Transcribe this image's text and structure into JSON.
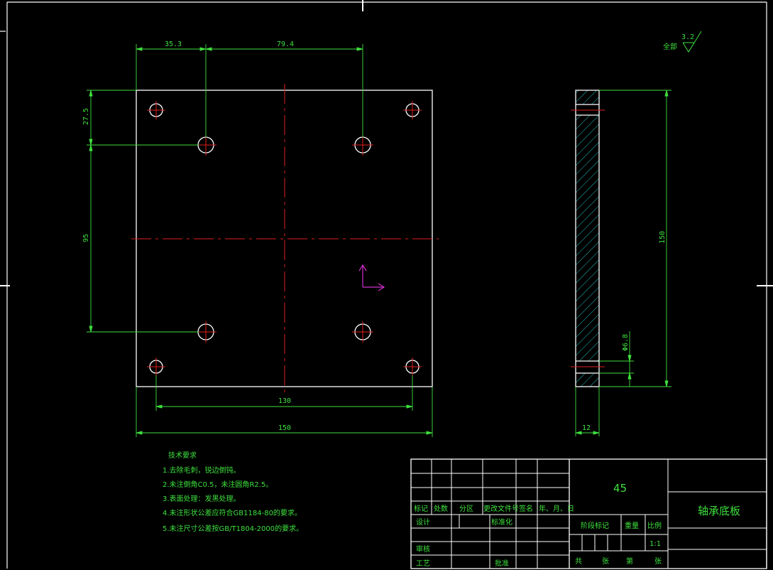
{
  "dimensions": {
    "top_left": "35.3",
    "top_mid": "79.4",
    "left_top": "27.5",
    "left_mid": "95",
    "bottom_inner": "130",
    "bottom_outer": "150",
    "side_height": "150",
    "side_hole": "Φ6.8",
    "side_width": "12"
  },
  "roughness": {
    "label": "全部",
    "value": "3.2"
  },
  "tech_notes": {
    "title": "技术要求",
    "items": [
      "1.去除毛刺，锐边倒钝。",
      "2.未注倒角C0.5，未注圆角R2.5。",
      "3.表面处理：发黑处理。",
      "4.未注形状公差应符合GB1184-80的要求。",
      "5.未注尺寸公差按GB/T1804-2000的要求。"
    ]
  },
  "title_block": {
    "material": "45",
    "part_name": "轴承底板",
    "header_row": [
      "标记",
      "处数",
      "分区",
      "更改文件号",
      "签名",
      "年、月、日"
    ],
    "design": "设计",
    "standardize": "标准化",
    "review": "审核",
    "process": "工艺",
    "approve": "批准",
    "stage_mark": "阶段标记",
    "weight": "重量",
    "scale": "比例",
    "scale_value": "1:1",
    "sheets": [
      "共",
      "张",
      "第",
      "张"
    ]
  },
  "colors": {
    "outline": "#ffffff",
    "dimension": "#3ee03e",
    "centerline": "#e02020",
    "hatch": "#20c0c0",
    "ucs": "#d030d0"
  }
}
